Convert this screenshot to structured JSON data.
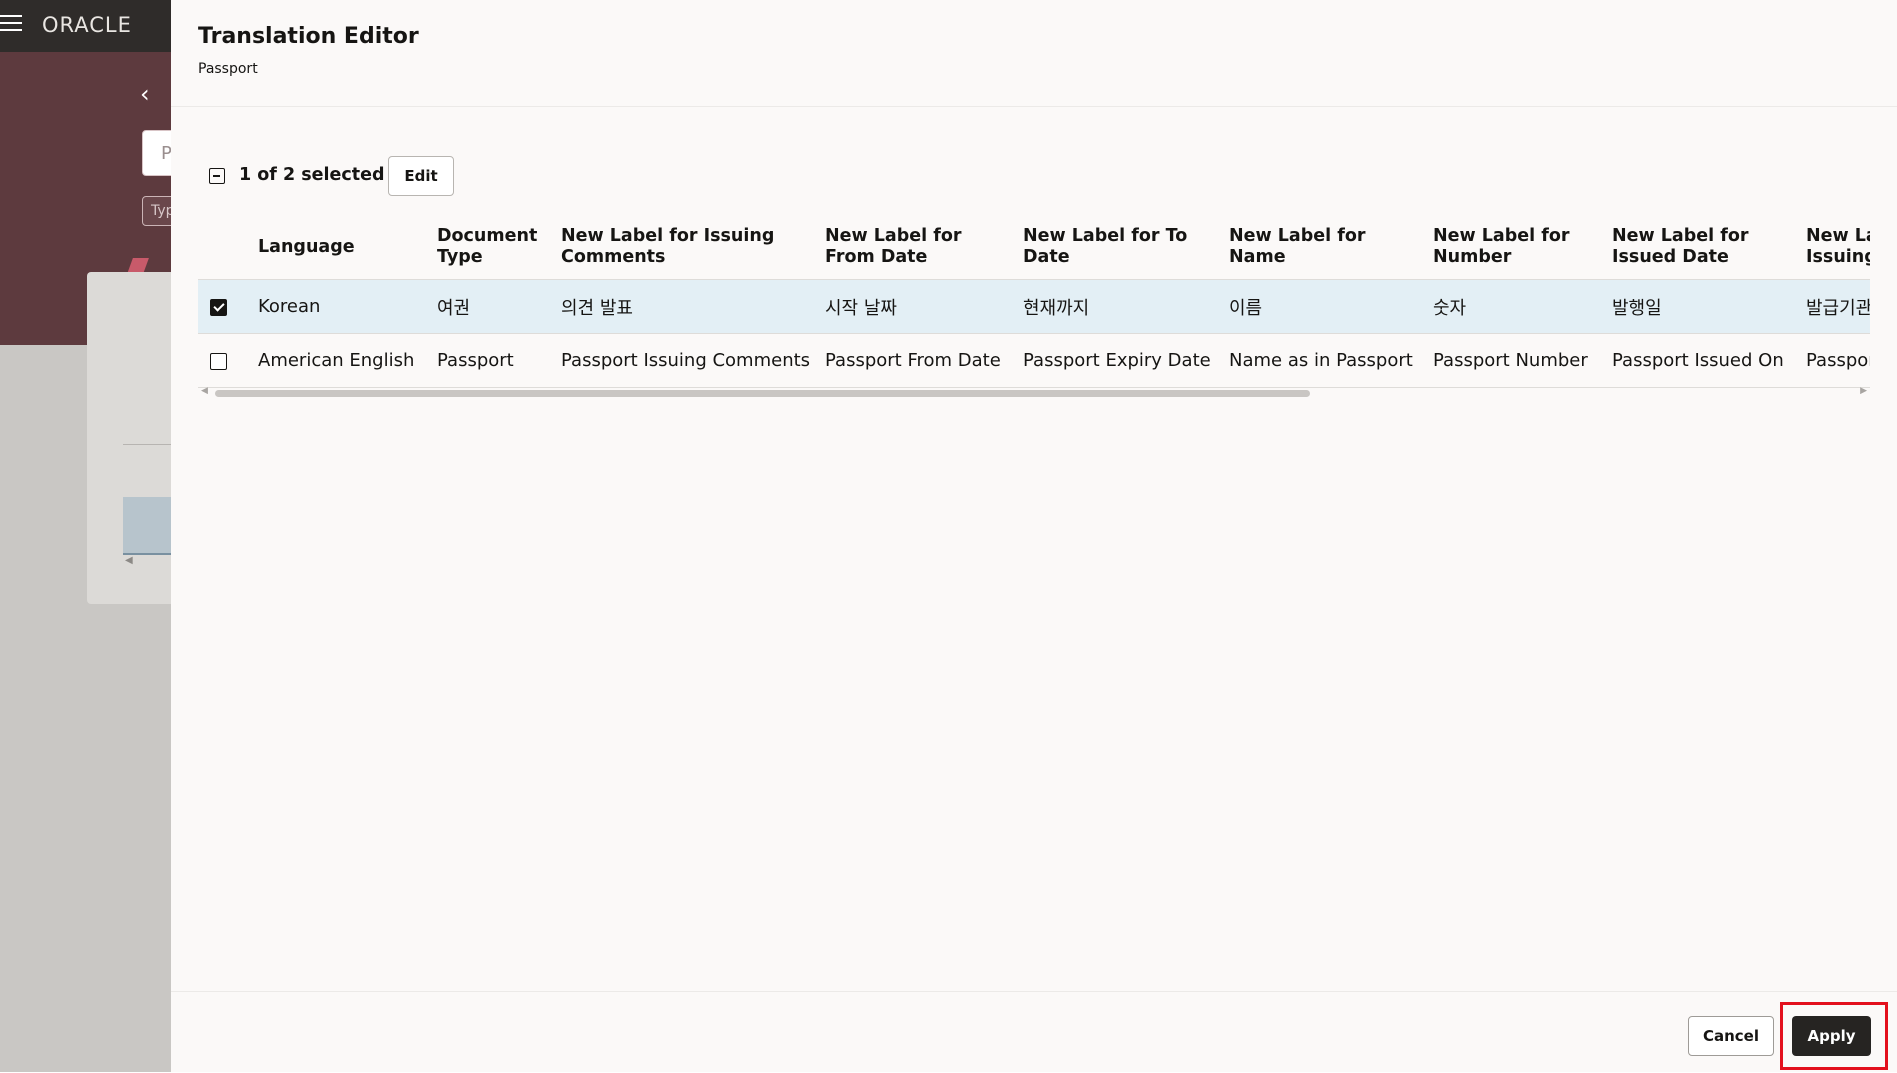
{
  "background_app": {
    "logo": "ORACLE",
    "field1_text": "P",
    "field2_text": "Typ"
  },
  "drawer": {
    "title": "Translation Editor",
    "subtitle": "Passport"
  },
  "toolbar": {
    "selection_count": "1 of 2 selected",
    "edit_label": "Edit"
  },
  "table": {
    "columns": [
      "Language",
      "Document Type",
      "New Label for Issuing Comments",
      "New Label for From Date",
      "New Label for To Date",
      "New Label for Name",
      "New Label for Number",
      "New Label for Issued Date",
      "New Label for Issuing Authority"
    ],
    "rows": [
      {
        "selected": true,
        "cells": [
          "Korean",
          "여권",
          "의견 발표",
          "시작 날짜",
          "현재까지",
          "이름",
          "숫자",
          "발행일",
          "발급기관"
        ]
      },
      {
        "selected": false,
        "cells": [
          "American English",
          "Passport",
          "Passport Issuing Comments",
          "Passport From Date",
          "Passport Expiry Date",
          "Name as in Passport",
          "Passport Number",
          "Passport Issued On",
          "Passport Issuing Authority"
        ]
      }
    ]
  },
  "footer": {
    "cancel_label": "Cancel",
    "apply_label": "Apply"
  },
  "colors": {
    "banner": "#5d3a3e",
    "selected_row": "#e3eff5",
    "apply_button": "#262422",
    "highlight": "#e3101d"
  }
}
